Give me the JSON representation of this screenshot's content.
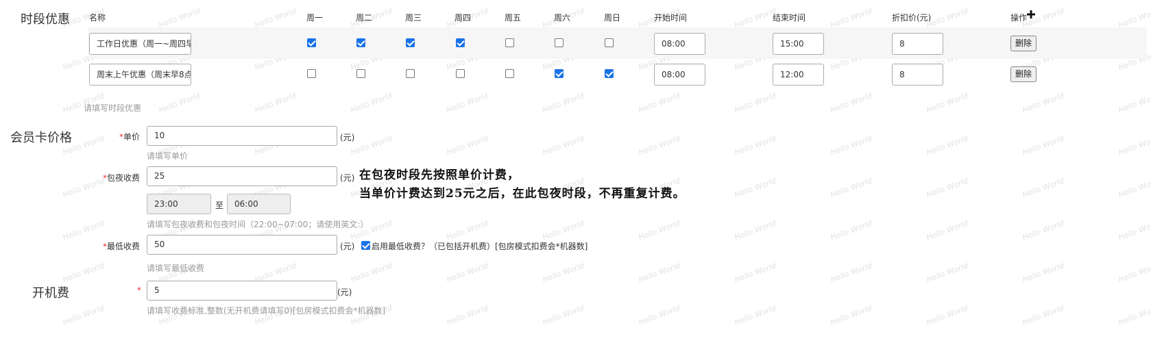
{
  "sections": {
    "time_discount": "时段优惠",
    "member_price": "会员卡价格",
    "boot_fee": "开机费"
  },
  "table": {
    "headers": {
      "name": "名称",
      "mon": "周一",
      "tue": "周二",
      "wed": "周三",
      "thu": "周四",
      "fri": "周五",
      "sat": "周六",
      "sun": "周日",
      "start": "开始时间",
      "end": "结束时间",
      "discount": "折扣价(元)",
      "action": "操作"
    },
    "add_icon": "plus-icon",
    "rows": [
      {
        "name": "工作日优惠（周一~周四早",
        "days": [
          true,
          true,
          true,
          true,
          false,
          false,
          false
        ],
        "start": "08:00",
        "end": "15:00",
        "price": "8",
        "delete": "删除"
      },
      {
        "name": "周末上午优惠（周末早8点",
        "days": [
          false,
          false,
          false,
          false,
          false,
          true,
          true
        ],
        "start": "08:00",
        "end": "12:00",
        "price": "8",
        "delete": "删除"
      }
    ],
    "hint": "请填写时段优惠"
  },
  "member": {
    "unit_price": {
      "label": "单价",
      "value": "10",
      "unit": "(元)",
      "hint": "请填写单价"
    },
    "overnight": {
      "label": "包夜收费",
      "value": "25",
      "unit": "(元)",
      "from": "23:00",
      "sep": "至",
      "to": "06:00",
      "hint": "请填写包夜收费和包夜时间（22:00~07:00；请使用英文:）"
    },
    "min_charge": {
      "label": "最低收费",
      "value": "50",
      "unit": "(元)",
      "checkbox_checked": true,
      "checkbox_label": "启用最低收费？（已包括开机费）[包房模式扣费会*机器数]",
      "hint": "请填写最低收费"
    }
  },
  "boot": {
    "value": "5",
    "unit": "(元)",
    "hint": "请填写收费标准,整数(无开机费请填写0)[包房模式扣费会*机器数]"
  },
  "annotation": {
    "line1": "在包夜时段先按照单价计费，",
    "line2": "当单价计费达到25元之后，在此包夜时段，不再重复计费。"
  },
  "watermark": "Hello World"
}
